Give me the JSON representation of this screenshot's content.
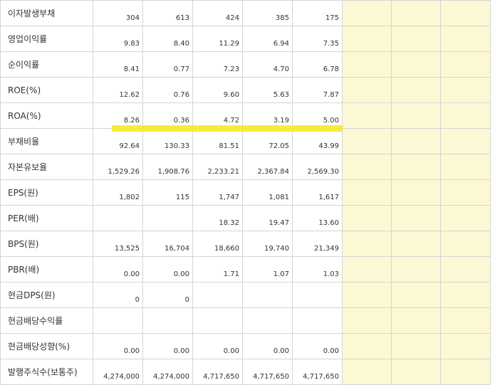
{
  "table": {
    "value_columns": 5,
    "empty_columns": 3,
    "rows": [
      {
        "label": "이자발생부채",
        "values": [
          "304",
          "613",
          "424",
          "385",
          "175"
        ]
      },
      {
        "label": "영업이익률",
        "values": [
          "9.83",
          "8.40",
          "11.29",
          "6.94",
          "7.35"
        ]
      },
      {
        "label": "순이익률",
        "values": [
          "8.41",
          "0.77",
          "7.23",
          "4.70",
          "6.78"
        ]
      },
      {
        "label": "ROE(%)",
        "values": [
          "12.62",
          "0.76",
          "9.60",
          "5.63",
          "7.87"
        ]
      },
      {
        "label": "ROA(%)",
        "values": [
          "8.26",
          "0.36",
          "4.72",
          "3.19",
          "5.00"
        ]
      },
      {
        "label": "부채비율",
        "values": [
          "92.64",
          "130.33",
          "81.51",
          "72.05",
          "43.99"
        ]
      },
      {
        "label": "자본유보율",
        "values": [
          "1,529.26",
          "1,908.76",
          "2,233.21",
          "2,367.84",
          "2,569.30"
        ]
      },
      {
        "label": "EPS(원)",
        "values": [
          "1,802",
          "115",
          "1,747",
          "1,081",
          "1,617"
        ]
      },
      {
        "label": "PER(배)",
        "values": [
          "",
          "",
          "18.32",
          "19.47",
          "13.60"
        ]
      },
      {
        "label": "BPS(원)",
        "values": [
          "13,525",
          "16,704",
          "18,660",
          "19,740",
          "21,349"
        ]
      },
      {
        "label": "PBR(배)",
        "values": [
          "0.00",
          "0.00",
          "1.71",
          "1.07",
          "1.03"
        ]
      },
      {
        "label": "현금DPS(원)",
        "values": [
          "0",
          "0",
          "",
          "",
          ""
        ]
      },
      {
        "label": "현금배당수익률",
        "values": [
          "",
          "",
          "",
          "",
          ""
        ]
      },
      {
        "label": "현금배당성향(%)",
        "values": [
          "0.00",
          "0.00",
          "0.00",
          "0.00",
          "0.00"
        ]
      },
      {
        "label": "발행주식수(보통주)",
        "values": [
          "4,274,000",
          "4,274,000",
          "4,717,650",
          "4,717,650",
          "4,717,650"
        ]
      }
    ]
  },
  "highlight": {
    "color": "#f4ea17",
    "row_label": "부채비율"
  },
  "colors": {
    "empty_column_bg": "#fdf8d4",
    "border": "#d5d5d5"
  }
}
